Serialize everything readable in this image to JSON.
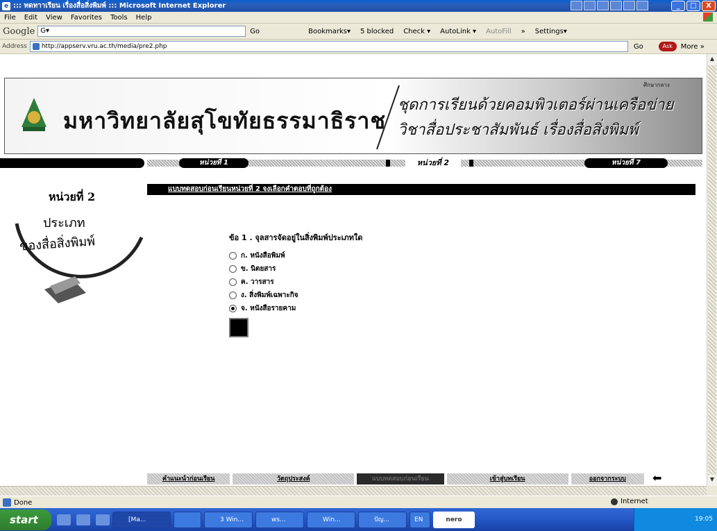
{
  "window": {
    "title": "::: ทดทาาเรียน เรื่องสื่อสิ่งพิมพ์ ::: Microsoft Internet Explorer",
    "minimize": "_",
    "maximize": "□",
    "close": "X"
  },
  "menu": {
    "items": [
      "File",
      "Edit",
      "View",
      "Favorites",
      "Tools",
      "Help"
    ]
  },
  "toolbar": {
    "google_logo": "Google",
    "google_value": "G▾",
    "go_label": "Go",
    "bookmarks": "Bookmarks▾",
    "blocked": "5 blocked",
    "check": "Check ▾",
    "autolink": "AutoLink ▾",
    "autofill": "AutoFill",
    "overflow": "»",
    "settings": "Settings▾"
  },
  "address": {
    "label": "Address",
    "url": "http://appserv.vru.ac.th/media/pre2.php",
    "go": "Go",
    "ask": "Ask",
    "more": "More »"
  },
  "banner": {
    "university": "มหาวิทยาลัยสุโขทัยธรรมาธิราช",
    "course_line1": "ชุดการเรียนด้วยคอมพิวเตอร์ผ่านเครือข่าย",
    "course_line2": "วิชาสื่อประชาสัมพันธ์ เรื่องสื่อสิ่งพิมพ์",
    "tag": "ศึกษากลาง"
  },
  "nav": {
    "unit1": "หน่วยที่ 1",
    "current": "หน่วยที่ 2",
    "unit7": "หน่วยที่ 7"
  },
  "sidebar": {
    "unit": "หน่วยที่ 2",
    "title1": "ประเภท",
    "title2": "ของสื่อสิ่งพิมพ์"
  },
  "section_header": "แบบทดสอบก่อนเรียนหน่วยที่ 2 จงเลือกคำตอบที่ถูกต้อง",
  "quiz": {
    "question": "ข้อ 1 . จุลสารจัดอยู่ในสิ่งพิมพ์ประเภทใด",
    "options": [
      {
        "label": "ก. หนังสือพิมพ์",
        "checked": false
      },
      {
        "label": "ข. นิตยสาร",
        "checked": false
      },
      {
        "label": "ค. วารสาร",
        "checked": false
      },
      {
        "label": "ง. สิ่งพิมพ์เฉพาะกิจ",
        "checked": false
      },
      {
        "label": "จ. หนังสือรายคาม",
        "checked": true
      }
    ]
  },
  "footer_nav": {
    "items": [
      "คำแนะนำก่อนเรียน",
      "วัตถุประสงค์",
      "แบบทดสอบก่อนเรียน",
      "เข้าสู่บทเรียน",
      "ออกจากระบบ"
    ],
    "back": "⬅"
  },
  "status": {
    "text": "Done",
    "zone": "Internet"
  },
  "taskbar": {
    "start": "start",
    "tasks": [
      "[Ma...",
      "",
      "3 Win...",
      "ws...",
      "Win...",
      "ปัญ...",
      "EN"
    ],
    "nero": "nero",
    "clock": "19:05"
  },
  "colors": {
    "titlebar": "#2a5fb8",
    "taskbar": "#2457c5",
    "start": "#3c9a3c",
    "ie_chrome": "#ece9d8"
  }
}
